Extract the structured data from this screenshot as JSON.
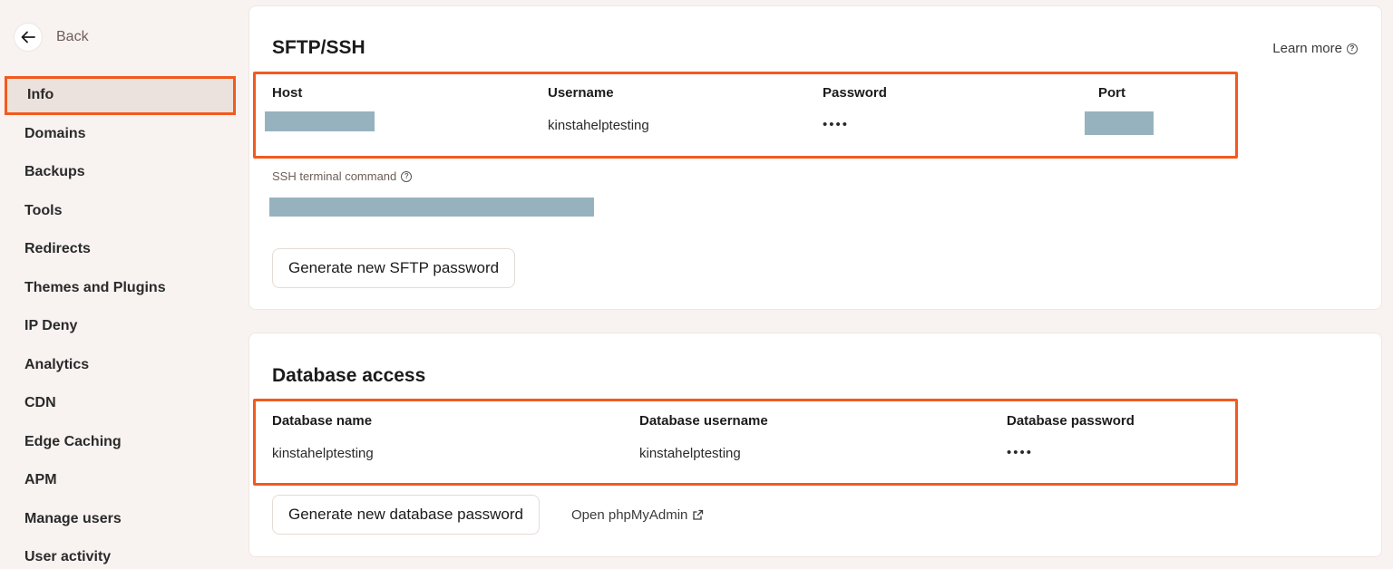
{
  "nav": {
    "back_label": "Back",
    "items": [
      {
        "label": "Info",
        "active": true
      },
      {
        "label": "Domains"
      },
      {
        "label": "Backups"
      },
      {
        "label": "Tools"
      },
      {
        "label": "Redirects"
      },
      {
        "label": "Themes and Plugins"
      },
      {
        "label": "IP Deny"
      },
      {
        "label": "Analytics"
      },
      {
        "label": "CDN"
      },
      {
        "label": "Edge Caching"
      },
      {
        "label": "APM"
      },
      {
        "label": "Manage users"
      },
      {
        "label": "User activity"
      }
    ]
  },
  "sftp": {
    "title": "SFTP/SSH",
    "learn_more": "Learn more",
    "columns": {
      "host": "Host",
      "username": "Username",
      "password": "Password",
      "port": "Port"
    },
    "values": {
      "username": "kinstahelptesting",
      "password": "••••"
    },
    "ssh_label": "SSH terminal command",
    "generate_button": "Generate new SFTP password"
  },
  "database": {
    "title": "Database access",
    "columns": {
      "name": "Database name",
      "username": "Database username",
      "password": "Database password"
    },
    "values": {
      "name": "kinstahelptesting",
      "username": "kinstahelptesting",
      "password": "••••"
    },
    "generate_button": "Generate new database password",
    "phpmyadmin_link": "Open phpMyAdmin"
  },
  "colors": {
    "highlight": "#f25a1f",
    "redaction": "#97b2bf",
    "background": "#f8f3f1"
  }
}
